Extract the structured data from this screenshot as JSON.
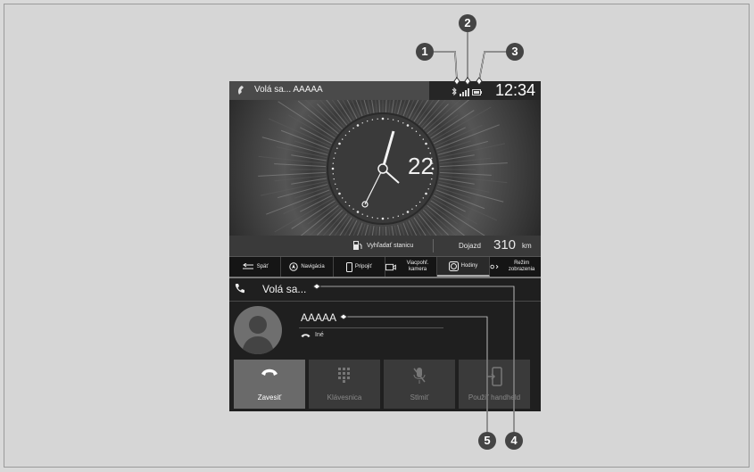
{
  "topbar": {
    "call_status": "Volá sa... AAAAA",
    "time": "12:34"
  },
  "clock": {
    "date_number": "22"
  },
  "station_bar": {
    "find_station": "Vyhľadať stanicu",
    "range_label": "Dojazd",
    "range_value": "310",
    "range_unit": "km"
  },
  "toolbar": [
    {
      "label": "Späť",
      "icon": "back-arrow-icon"
    },
    {
      "label": "Navigácia",
      "icon": "compass-icon"
    },
    {
      "label": "Pripojiť",
      "icon": "phone-device-icon"
    },
    {
      "label": "Viacpohľ. kamera",
      "icon": "camera-icon"
    },
    {
      "label": "Hodiny",
      "icon": "clock-icon"
    },
    {
      "label": "Režim zobrazenia",
      "icon": "display-mode-icon"
    }
  ],
  "call": {
    "status_label": "Volá sa...",
    "contact_name": "AAAAA",
    "contact_type": "Iné"
  },
  "actions": [
    {
      "label": "Zavesiť",
      "icon": "hang-up-icon"
    },
    {
      "label": "Klávesnica",
      "icon": "keypad-icon"
    },
    {
      "label": "Stlmiť",
      "icon": "mute-mic-icon"
    },
    {
      "label": "Použiť handheld",
      "icon": "handheld-icon"
    }
  ],
  "callouts": [
    "1",
    "2",
    "3",
    "4",
    "5"
  ]
}
